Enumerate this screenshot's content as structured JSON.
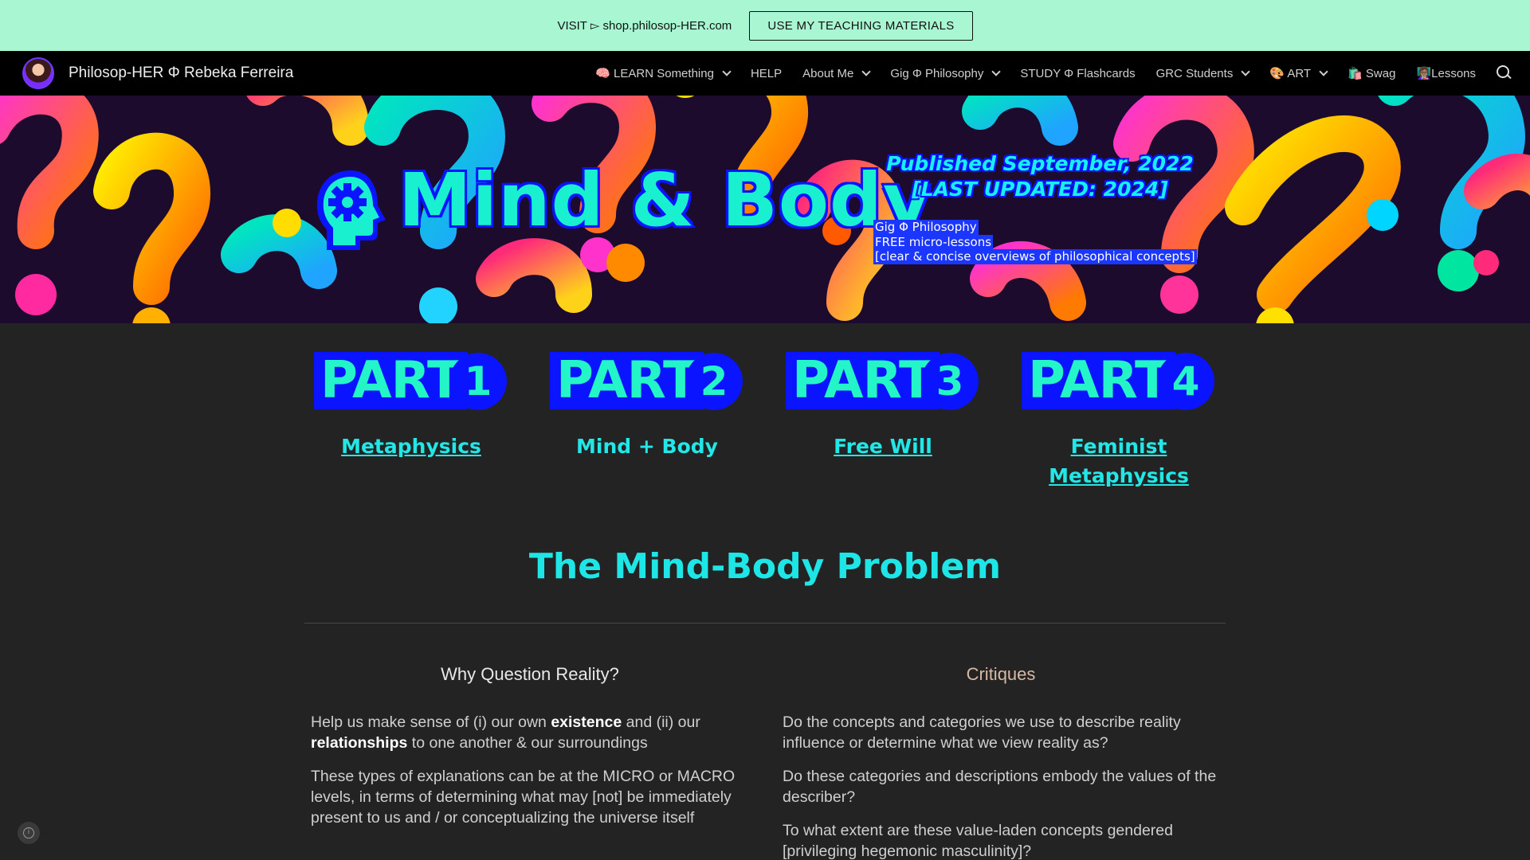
{
  "banner": {
    "text": "VISIT ▻ shop.philosop-HER.com",
    "button": "USE MY TEACHING MATERIALS"
  },
  "nav": {
    "site_title": "Philosop-HER Φ Rebeka Ferreira",
    "items": [
      {
        "label": "🧠 LEARN Something",
        "dropdown": true
      },
      {
        "label": "HELP",
        "dropdown": false
      },
      {
        "label": "About Me",
        "dropdown": true
      },
      {
        "label": "Gig Φ Philosophy",
        "dropdown": true
      },
      {
        "label": "STUDY Φ Flashcards",
        "dropdown": false
      },
      {
        "label": "GRC Students",
        "dropdown": true
      },
      {
        "label": "🎨 ART",
        "dropdown": true
      },
      {
        "label": "🛍️ Swag",
        "dropdown": false
      },
      {
        "label": "👩🏽‍🏫Lessons",
        "dropdown": false
      }
    ]
  },
  "hero": {
    "title": "Mind & Body",
    "published": "Published September, 2022 [LAST UPDATED: 2024]",
    "micro_lines": [
      "Gig Φ Philosophy",
      "FREE micro-lessons",
      "[clear & concise overviews of philosophical concepts]"
    ]
  },
  "parts": [
    {
      "word": "PART",
      "num": "1",
      "link": "Metaphysics",
      "underlined": true
    },
    {
      "word": "PART",
      "num": "2",
      "link": "Mind + Body",
      "underlined": false
    },
    {
      "word": "PART",
      "num": "3",
      "link": "Free Will",
      "underlined": true
    },
    {
      "word": "PART",
      "num": "4",
      "link": "Feminist Metaphysics",
      "underlined": true
    }
  ],
  "section_title": "The Mind-Body Problem",
  "left_column": {
    "heading": "Why Question Reality?",
    "p1_a": "Help us make sense of (i) our own ",
    "p1_b": "existence",
    "p1_c": " and (ii) our ",
    "p1_d": "relationships",
    "p1_e": " to one another & our surroundings",
    "p2": "These types of explanations can be at the MICRO or MACRO levels, in terms of determining what may [not] be immediately present to us and / or conceptualizing the universe itself"
  },
  "right_column": {
    "heading": "Critiques",
    "paragraphs": [
      "Do the concepts and categories we use to describe reality influence or determine what we view reality as?",
      "Do these categories and descriptions embody the values of the describer?",
      "To what extent are these value-laden concepts gendered [privileging hegemonic masculinity]?"
    ]
  },
  "colors": {
    "banner_bg": "#a8f7d2",
    "accent_cyan": "#1ee6e6",
    "accent_blue": "#0a14ff",
    "page_bg": "#232323"
  }
}
